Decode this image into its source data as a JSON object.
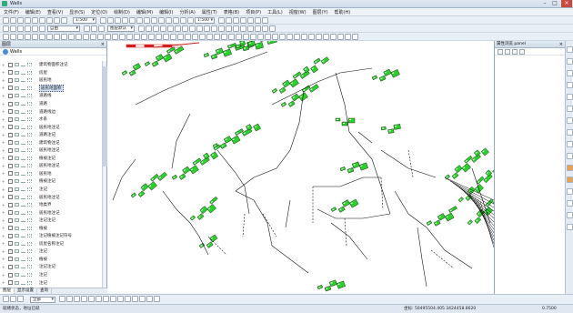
{
  "window": {
    "title": "Walls"
  },
  "menu": [
    "文件(F)",
    "编辑(E)",
    "查看(V)",
    "显示(S)",
    "定位(O)",
    "绘制(D)",
    "编辑(M)",
    "编辑(I)",
    "分析(A)",
    "属性(T)",
    "表格(B)",
    "项目(P)",
    "工具(L)",
    "视窗(W)",
    "图层(Y)",
    "帮助(H)"
  ],
  "toolbar": {
    "scale_value": "1:500",
    "layer_combo": "图层默认",
    "style_combo": "自由",
    "line_combo": "1:500"
  },
  "left_panel": {
    "title": "图层",
    "root_label": "Walls",
    "layers": [
      "建筑物面积注记",
      "房屋",
      "居民地",
      "居民地面积",
      "道路线",
      "道路",
      "道路线边",
      "水系",
      "居民地注记",
      "道路注记",
      "建筑物注记",
      "居民地注记",
      "植被注记",
      "居民地注记",
      "居民地",
      "植被注记",
      "注记",
      "居民地注记",
      "地类界",
      "居民地注记",
      "注记注记",
      "植被",
      "注记植被注记符号",
      "房屋名称注记",
      "注记",
      "植被",
      "注记注记",
      "注记",
      "注记"
    ],
    "selected_index": 3,
    "tabs": [
      "图层",
      "显示设置",
      "查询"
    ]
  },
  "right_panel": {
    "title": "属性浏览 panel"
  },
  "bottom": {
    "combo_value": "全部"
  },
  "status": {
    "left": "就绪状态，地址已就",
    "coords": "坐标: 50495504.405  3424458.8620",
    "scale": "0.7500"
  },
  "colors": {
    "map_green": "#2bd12b",
    "map_line": "#111111",
    "accent_red": "#d22020"
  }
}
